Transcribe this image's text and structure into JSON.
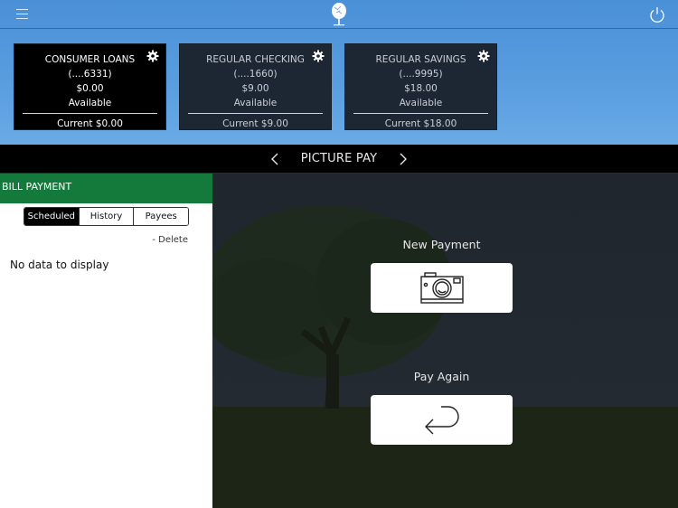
{
  "header": {
    "menu_icon": "hamburger-menu-icon",
    "logo_icon": "tree-logo-icon",
    "power_icon": "power-icon"
  },
  "accounts": [
    {
      "name": "CONSUMER LOANS",
      "number": "(....6331)",
      "amount": "$0.00",
      "amount_label": "Available",
      "current": "Current $0.00",
      "selected": true
    },
    {
      "name": "REGULAR CHECKING",
      "number": "(....1660)",
      "amount": "$9.00",
      "amount_label": "Available",
      "current": "Current $9.00",
      "selected": false
    },
    {
      "name": "REGULAR SAVINGS",
      "number": "(....9995)",
      "amount": "$18.00",
      "amount_label": "Available",
      "current": "Current $18.00",
      "selected": false
    }
  ],
  "nav": {
    "title": "PICTURE PAY",
    "prev_icon": "chevron-left-icon",
    "next_icon": "chevron-right-icon"
  },
  "bill_payment": {
    "title": "BILL PAYMENT",
    "tabs": [
      "Scheduled",
      "History",
      "Payees"
    ],
    "active_tab": "Scheduled",
    "delete_label": "- Delete",
    "empty_text": "No data to display"
  },
  "actions": {
    "new_payment_label": "New Payment",
    "new_payment_icon": "camera-icon",
    "pay_again_label": "Pay Again",
    "pay_again_icon": "return-arrow-icon"
  },
  "colors": {
    "header_blue": "#4a90d6",
    "bill_payment_green": "#147a3c",
    "card_dark": "#1d2733",
    "card_selected": "#000000"
  }
}
